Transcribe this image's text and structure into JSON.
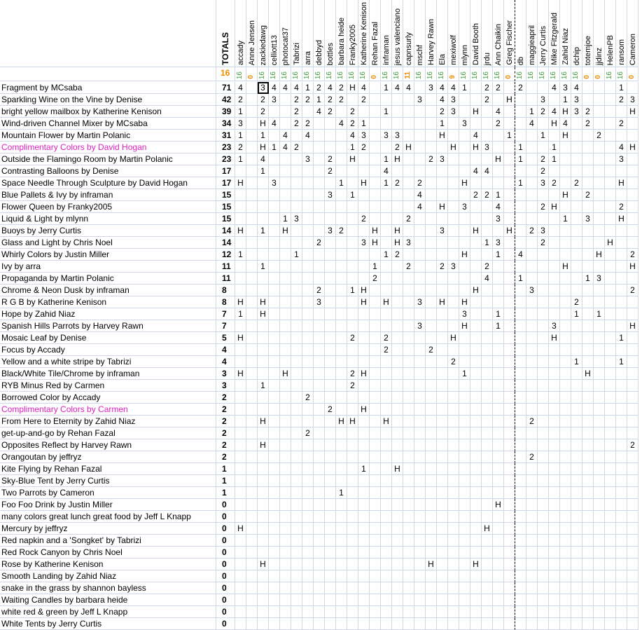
{
  "sheet": {
    "totals_header": "TOTALS",
    "totals_count": "16",
    "highlight_color": "#e020c0",
    "count_green": "#3a9b3a",
    "count_orange": "#f08c00",
    "columns": [
      {
        "name": "accady",
        "count": "16",
        "c": "g"
      },
      {
        "name": "Anne Jensen",
        "count": "0",
        "c": "o"
      },
      {
        "name": "zackiedawg",
        "count": "16",
        "c": "g"
      },
      {
        "name": "celliott13",
        "count": "16",
        "c": "g"
      },
      {
        "name": "photocat37",
        "count": "16",
        "c": "g"
      },
      {
        "name": "Tabrizi",
        "count": "16",
        "c": "g"
      },
      {
        "name": "arra",
        "count": "16",
        "c": "g"
      },
      {
        "name": "debbyd",
        "count": "16",
        "c": "g"
      },
      {
        "name": "bottles",
        "count": "16",
        "c": "g"
      },
      {
        "name": "barbara heide",
        "count": "16",
        "c": "g"
      },
      {
        "name": "Franky2005",
        "count": "16",
        "c": "g"
      },
      {
        "name": "Katherine Kenison",
        "count": "16",
        "c": "g"
      },
      {
        "name": "Rehan Fazal",
        "count": "0",
        "c": "o"
      },
      {
        "name": "inframan",
        "count": "16",
        "c": "g"
      },
      {
        "name": "jesus valenciano",
        "count": "16",
        "c": "g"
      },
      {
        "name": "capnsurly",
        "count": "11",
        "c": "o"
      },
      {
        "name": "mschf",
        "count": "16",
        "c": "g"
      },
      {
        "name": "Harvey Rawn",
        "count": "16",
        "c": "g"
      },
      {
        "name": "Ela",
        "count": "16",
        "c": "g"
      },
      {
        "name": "mexiwolf",
        "count": "9",
        "c": "o"
      },
      {
        "name": "mlynn",
        "count": "16",
        "c": "g"
      },
      {
        "name": "David Booth",
        "count": "16",
        "c": "g"
      },
      {
        "name": "jrdu",
        "count": "16",
        "c": "g"
      },
      {
        "name": "Ann Chaikin",
        "count": "16",
        "c": "g"
      },
      {
        "name": "Greg Fischer",
        "count": "0",
        "c": "o"
      },
      {
        "name": "db",
        "count": "16",
        "c": "g"
      },
      {
        "name": "maggieapril",
        "count": "16",
        "c": "g"
      },
      {
        "name": "Jerry Curtis",
        "count": "16",
        "c": "g"
      },
      {
        "name": "Mike Fitzgerald",
        "count": "16",
        "c": "g"
      },
      {
        "name": "Zahid Niaz",
        "count": "16",
        "c": "g"
      },
      {
        "name": "dchip",
        "count": "16",
        "c": "g"
      },
      {
        "name": "totemjoe",
        "count": "0",
        "c": "o"
      },
      {
        "name": "jjdinz",
        "count": "0",
        "c": "o"
      },
      {
        "name": "HelenPB",
        "count": "16",
        "c": "g"
      },
      {
        "name": "ransom",
        "count": "16",
        "c": "g"
      },
      {
        "name": "Cameron",
        "count": "0",
        "c": "o"
      }
    ],
    "rows": [
      {
        "title": "Fragment by MCsaba",
        "total": "71",
        "hl": false,
        "scores": "4||3|4|4|4|1|2|4|2|H|4||1|4|4||3|4|4|1||2|2||2|||4|3|4||||1|"
      },
      {
        "title": "Sparkling Wine on the Vine by Denise",
        "total": "42",
        "hl": false,
        "scores": "2||2|3||2|2|1|2|2||2|||||3||4|3|||2||H|||3||1|3||||2|3"
      },
      {
        "title": "bright yellow mailbox by Katherine Kenison",
        "total": "39",
        "hl": false,
        "scores": "1||2|||2||4|2||2|||1|||||2|3||H||4|||1|2|4|H|3|2||||H|4"
      },
      {
        "title": "Wind-driven Channel Mixer by MCsaba",
        "total": "34",
        "hl": false,
        "scores": "3||H|4||2|2|||4|2|1|||||||1||3|||2|||4||H|4||2|||2|"
      },
      {
        "title": "Mountain Flower by Martin Polanic",
        "total": "31",
        "hl": false,
        "scores": "1||1||4||4||||4|3||3|3||||H|||4|||1|||1||H|||2|"
      },
      {
        "title": "Complimentary Colors by David Hogan",
        "total": "23",
        "hl": true,
        "scores": "2||H|1|4|2|||||1|2|||2|H||||H||H|3|||1|||1||||||4|H"
      },
      {
        "title": "Outside the Flamingo Room by Martin Polanic",
        "total": "23",
        "hl": false,
        "scores": "1||4||||3||2||H|||1|H|||2|3|||||H||1||2|1||||||3"
      },
      {
        "title": "Contrasting Balloons by Denise",
        "total": "17",
        "hl": false,
        "scores": "||1||||||2|||||4||||||||4|4|||||2|||||||"
      },
      {
        "title": "Space Needle Through Sculpture by David Hogan",
        "total": "17",
        "hl": false,
        "scores": "H|||3||||||1||H||1|2||2||||H|||||1||3|2||2||||H"
      },
      {
        "title": "Blue Pallets & Ivy by inframan",
        "total": "15",
        "hl": false,
        "scores": "||||||||3||1||||||4|||||2|2|1||||||H||2||||"
      },
      {
        "title": "Flower Queen by Franky2005",
        "total": "15",
        "hl": false,
        "scores": "||||||||||||||||4||H||3|||4||||2|H||||||2||"
      },
      {
        "title": "Liquid & Light by mlynn",
        "total": "15",
        "hl": false,
        "scores": "||||1|3||||||2||||2||||||||3||||||1||3|||H|"
      },
      {
        "title": "Buoys by Jerry Curtis",
        "total": "14",
        "hl": false,
        "scores": "H||1||H||||3|2|||H||H||||3|||H|||H||2|3||||||||"
      },
      {
        "title": "Glass and Light by Chris Noel",
        "total": "14",
        "hl": false,
        "scores": "|||||||2||||3|H||H|3|||||||1|3||||2||||||H||||"
      },
      {
        "title": "Whirly Colors by Justin Miller",
        "total": "12",
        "hl": false,
        "scores": "1|||||1||||||||1|2||||||H|||1||4|||||||H|||2||"
      },
      {
        "title": "Ivy by arra",
        "total": "11",
        "hl": false,
        "scores": "||1||||||||||1|||2|||2|3|||2|||||||H||||||H"
      },
      {
        "title": "Propaganda by Martin Polanic",
        "total": "11",
        "hl": false,
        "scores": "||||||||||||2||||||||||4|||1||||||1|3||||||"
      },
      {
        "title": "Chrome & Neon Dusk by inframan",
        "total": "8",
        "hl": false,
        "scores": "|||||||2|||1|H||||||||||H|||||3|||||||||2"
      },
      {
        "title": "R G B by Katherine Kenison",
        "total": "8",
        "hl": false,
        "scores": "H||H|||||3||||H||H|||3||H||H||||||||||2||||"
      },
      {
        "title": "Hope by Zahid Niaz",
        "total": "7",
        "hl": false,
        "scores": "1||H||||||||||||||||||3|||1|||||||1||1|||||"
      },
      {
        "title": "Spanish Hills Parrots by Harvey Rawn",
        "total": "7",
        "hl": false,
        "scores": "||||||||||||||||3||||H|||1|||||3|||||||H|H"
      },
      {
        "title": "Mosaic Leaf by Denise",
        "total": "5",
        "hl": false,
        "scores": "H||||||||||2|||2||||||H|||||||||H||||||1"
      },
      {
        "title": "Focus by Accady",
        "total": "4",
        "hl": false,
        "scores": "|||||||||||||2||||2||||||||||||||||||"
      },
      {
        "title": "Yellow and a white stripe by Tabrizi",
        "total": "4",
        "hl": false,
        "scores": "|||||||||||||||||||2|||||||||||1||||1||"
      },
      {
        "title": "Black/White Tile/Chrome by inframan",
        "total": "3",
        "hl": false,
        "scores": "H||||H||||||2|H|||||||||1|||||||||||H|||||"
      },
      {
        "title": "RYB Minus Red by Carmen",
        "total": "3",
        "hl": false,
        "scores": "||1||||||||2||||||||||||||||||||||||||"
      },
      {
        "title": "Borrowed Color by Accady",
        "total": "2",
        "hl": false,
        "scores": "||||||2||||||||||||||||||||||||||||||"
      },
      {
        "title": "Complimentary Colors by Carmen",
        "total": "2",
        "hl": true,
        "scores": "||||||||2|||H||||||||||||||||||||||||"
      },
      {
        "title": "From Here to Eternity by Zahid Niaz",
        "total": "2",
        "hl": false,
        "scores": "||H|||||||H|H|||H|||||||||||||2|||||||"
      },
      {
        "title": "get-up-and-go by Rehan Fazal",
        "total": "2",
        "hl": false,
        "scores": "||||||2||||||||||||||||||||||||||||||"
      },
      {
        "title": "Opposites Reflect by Harvey Rawn",
        "total": "2",
        "hl": false,
        "scores": "||H|||||||||||||||||||||||||||||||||2"
      },
      {
        "title": "Orangoutan by jeffryz",
        "total": "2",
        "hl": false,
        "scores": "||||||||||||||||||||||||||2||||||||||"
      },
      {
        "title": "Kite Flying by Rehan Fazal",
        "total": "1",
        "hl": false,
        "scores": "|||||||||||1|||H||||||||||||||||||||||"
      },
      {
        "title": "Sky-Blue Tent by Jerry Curtis",
        "total": "1",
        "hl": false,
        "scores": "||||||||||||||||||||||||||||||||||||1||"
      },
      {
        "title": "Two Parrots by Cameron",
        "total": "1",
        "hl": false,
        "scores": "|||||||||1||||||||||||||||||||||||||"
      },
      {
        "title": "Foo Foo Drink by Justin Miller",
        "total": "0",
        "hl": false,
        "scores": "|||||||||||||||||||||||H|||||||||||||"
      },
      {
        "title": "many colors great lunch great food by Jeff L Knapp",
        "total": "0",
        "hl": false,
        "scores": "||||||||||||||||||||||||||||||||||||"
      },
      {
        "title": "Mercury by jeffryz",
        "total": "0",
        "hl": false,
        "scores": "H||||||||||||||||||||||H||||||||||||"
      },
      {
        "title": "Red napkin and a 'Songket' by Tabrizi",
        "total": "0",
        "hl": false,
        "scores": "||||||||||||||||||||||||||||||||||||"
      },
      {
        "title": "Red Rock Canyon by Chris Noel",
        "total": "0",
        "hl": false,
        "scores": "||||||||||||||||||||||||||||||||||||"
      },
      {
        "title": "Rose by Katherine Kenison",
        "total": "0",
        "hl": false,
        "scores": "||H|||||||||||||||H||||H|||||||||||||"
      },
      {
        "title": "Smooth Landing by Zahid Niaz",
        "total": "0",
        "hl": false,
        "scores": "||||||||||||||||||||||||||||||||||||"
      },
      {
        "title": "snake in the grass by shannon bayless",
        "total": "0",
        "hl": false,
        "scores": "||||||||||||||||||||||||||||||||||||"
      },
      {
        "title": "Waiting Candles by barbara heide",
        "total": "0",
        "hl": false,
        "scores": "||||||||||||||||||||||||||||||||||||"
      },
      {
        "title": "white red & green by Jeff L Knapp",
        "total": "0",
        "hl": false,
        "scores": "||||||||||||||||||||||||||||||||||||"
      },
      {
        "title": "White Tents by Jerry Curtis",
        "total": "0",
        "hl": false,
        "scores": "||||||||||||||||||||||||||||||||||||"
      }
    ]
  }
}
